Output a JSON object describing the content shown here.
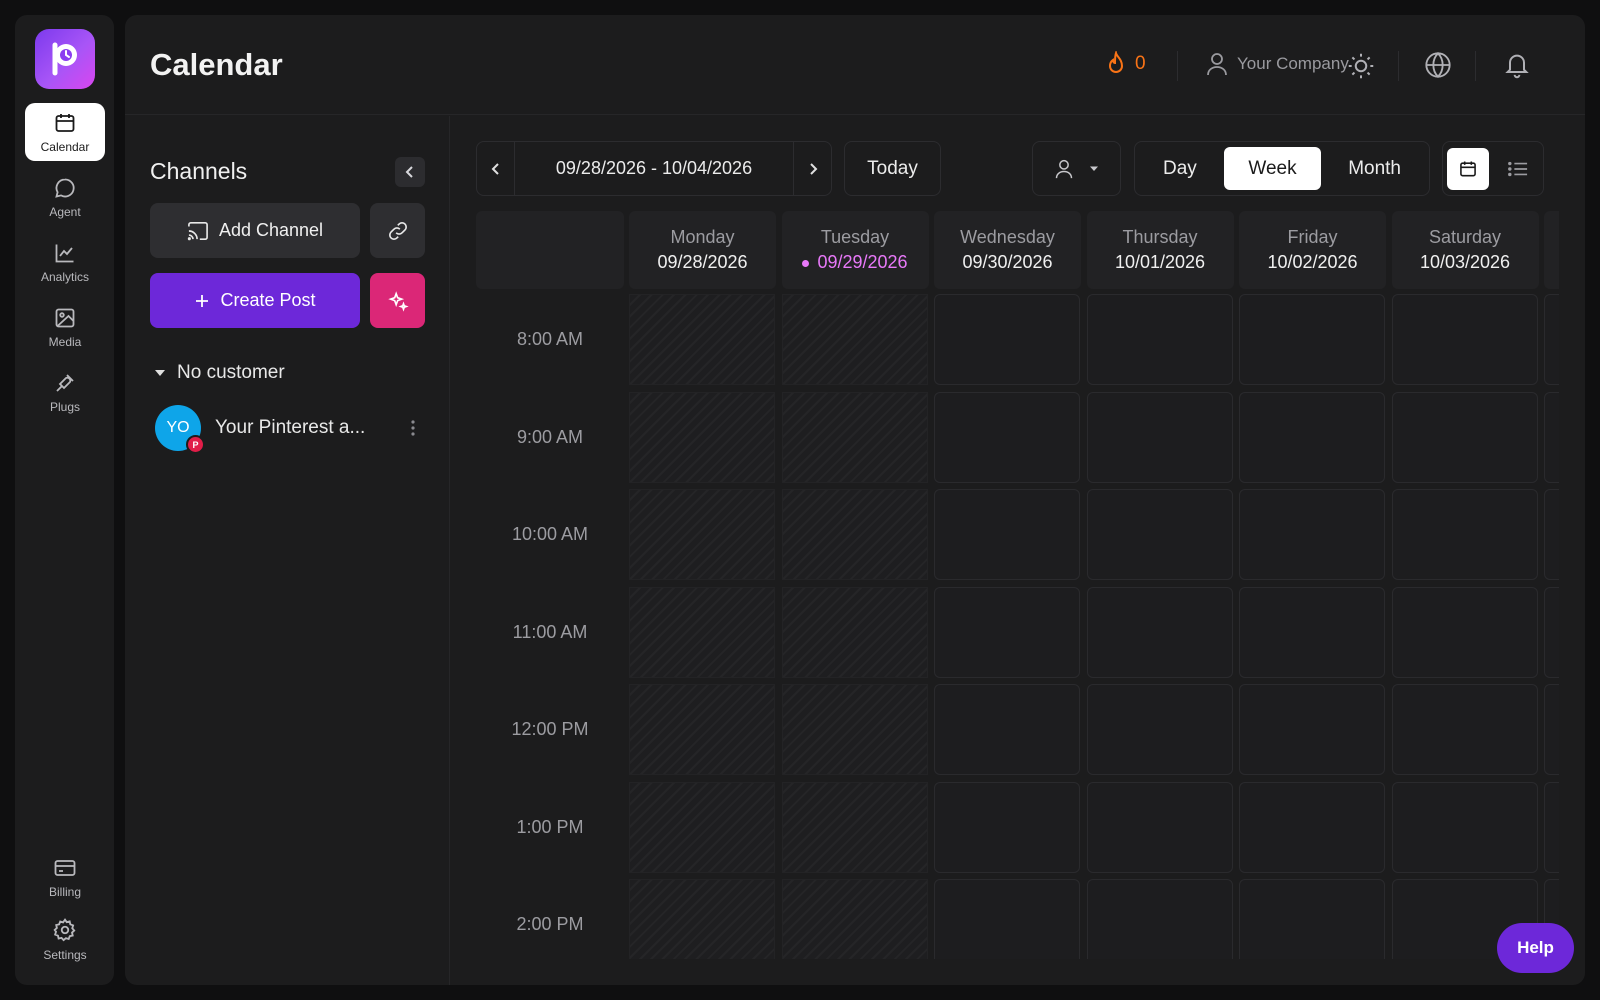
{
  "app": {
    "logo_icon": "postiz-logo-icon",
    "brand_gradient": [
      "#7c3aed",
      "#d946ef"
    ]
  },
  "nav": {
    "items": [
      {
        "label": "Calendar",
        "icon": "calendar-icon",
        "active": true
      },
      {
        "label": "Agent",
        "icon": "chat-bubble-icon"
      },
      {
        "label": "Analytics",
        "icon": "chart-line-icon"
      },
      {
        "label": "Media",
        "icon": "image-icon"
      },
      {
        "label": "Plugs",
        "icon": "plug-icon"
      }
    ],
    "bottom": [
      {
        "label": "Billing",
        "icon": "credit-card-icon"
      },
      {
        "label": "Settings",
        "icon": "gear-icon"
      }
    ]
  },
  "header": {
    "title": "Calendar",
    "streak_count": "0",
    "company": "Your Company"
  },
  "channels": {
    "title": "Channels",
    "add_channel": "Add Channel",
    "create_post": "Create Post",
    "customer_label": "No customer",
    "items": [
      {
        "initials": "YO",
        "name": "Your Pinterest a...",
        "platform_badge": "P"
      }
    ]
  },
  "calendar": {
    "range": "09/28/2026 - 10/04/2026",
    "today_label": "Today",
    "views": [
      "Day",
      "Week",
      "Month"
    ],
    "active_view": "Week",
    "days": [
      {
        "name": "Monday",
        "date": "09/28/2026",
        "past": true
      },
      {
        "name": "Tuesday",
        "date": "09/29/2026",
        "past": true,
        "current": true
      },
      {
        "name": "Wednesday",
        "date": "09/30/2026"
      },
      {
        "name": "Thursday",
        "date": "10/01/2026"
      },
      {
        "name": "Friday",
        "date": "10/02/2026"
      },
      {
        "name": "Saturday",
        "date": "10/03/2026"
      }
    ],
    "times": [
      "8:00 AM",
      "9:00 AM",
      "10:00 AM",
      "11:00 AM",
      "12:00 PM",
      "1:00 PM",
      "2:00 PM"
    ]
  },
  "help_label": "Help",
  "colors": {
    "accent": "#6d28d9",
    "current_day": "#e879f9",
    "streak": "#f97316",
    "ai_button": "#db2777",
    "avatar": "#0ea5e9"
  }
}
